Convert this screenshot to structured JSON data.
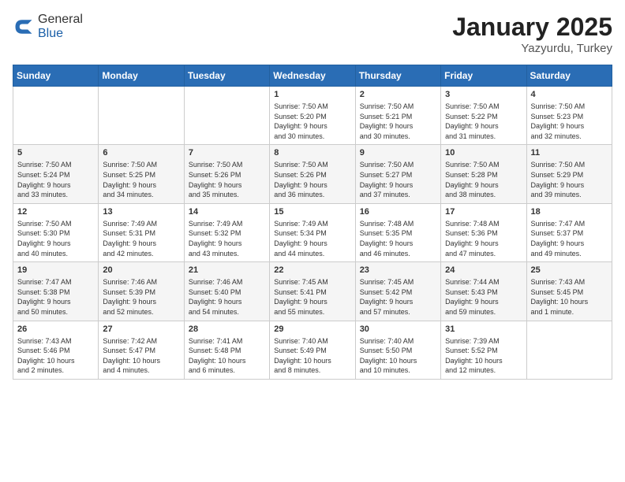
{
  "header": {
    "logo_general": "General",
    "logo_blue": "Blue",
    "title": "January 2025",
    "location": "Yazyurdu, Turkey"
  },
  "weekdays": [
    "Sunday",
    "Monday",
    "Tuesday",
    "Wednesday",
    "Thursday",
    "Friday",
    "Saturday"
  ],
  "weeks": [
    [
      {
        "day": "",
        "info": ""
      },
      {
        "day": "",
        "info": ""
      },
      {
        "day": "",
        "info": ""
      },
      {
        "day": "1",
        "info": "Sunrise: 7:50 AM\nSunset: 5:20 PM\nDaylight: 9 hours\nand 30 minutes."
      },
      {
        "day": "2",
        "info": "Sunrise: 7:50 AM\nSunset: 5:21 PM\nDaylight: 9 hours\nand 30 minutes."
      },
      {
        "day": "3",
        "info": "Sunrise: 7:50 AM\nSunset: 5:22 PM\nDaylight: 9 hours\nand 31 minutes."
      },
      {
        "day": "4",
        "info": "Sunrise: 7:50 AM\nSunset: 5:23 PM\nDaylight: 9 hours\nand 32 minutes."
      }
    ],
    [
      {
        "day": "5",
        "info": "Sunrise: 7:50 AM\nSunset: 5:24 PM\nDaylight: 9 hours\nand 33 minutes."
      },
      {
        "day": "6",
        "info": "Sunrise: 7:50 AM\nSunset: 5:25 PM\nDaylight: 9 hours\nand 34 minutes."
      },
      {
        "day": "7",
        "info": "Sunrise: 7:50 AM\nSunset: 5:26 PM\nDaylight: 9 hours\nand 35 minutes."
      },
      {
        "day": "8",
        "info": "Sunrise: 7:50 AM\nSunset: 5:26 PM\nDaylight: 9 hours\nand 36 minutes."
      },
      {
        "day": "9",
        "info": "Sunrise: 7:50 AM\nSunset: 5:27 PM\nDaylight: 9 hours\nand 37 minutes."
      },
      {
        "day": "10",
        "info": "Sunrise: 7:50 AM\nSunset: 5:28 PM\nDaylight: 9 hours\nand 38 minutes."
      },
      {
        "day": "11",
        "info": "Sunrise: 7:50 AM\nSunset: 5:29 PM\nDaylight: 9 hours\nand 39 minutes."
      }
    ],
    [
      {
        "day": "12",
        "info": "Sunrise: 7:50 AM\nSunset: 5:30 PM\nDaylight: 9 hours\nand 40 minutes."
      },
      {
        "day": "13",
        "info": "Sunrise: 7:49 AM\nSunset: 5:31 PM\nDaylight: 9 hours\nand 42 minutes."
      },
      {
        "day": "14",
        "info": "Sunrise: 7:49 AM\nSunset: 5:32 PM\nDaylight: 9 hours\nand 43 minutes."
      },
      {
        "day": "15",
        "info": "Sunrise: 7:49 AM\nSunset: 5:34 PM\nDaylight: 9 hours\nand 44 minutes."
      },
      {
        "day": "16",
        "info": "Sunrise: 7:48 AM\nSunset: 5:35 PM\nDaylight: 9 hours\nand 46 minutes."
      },
      {
        "day": "17",
        "info": "Sunrise: 7:48 AM\nSunset: 5:36 PM\nDaylight: 9 hours\nand 47 minutes."
      },
      {
        "day": "18",
        "info": "Sunrise: 7:47 AM\nSunset: 5:37 PM\nDaylight: 9 hours\nand 49 minutes."
      }
    ],
    [
      {
        "day": "19",
        "info": "Sunrise: 7:47 AM\nSunset: 5:38 PM\nDaylight: 9 hours\nand 50 minutes."
      },
      {
        "day": "20",
        "info": "Sunrise: 7:46 AM\nSunset: 5:39 PM\nDaylight: 9 hours\nand 52 minutes."
      },
      {
        "day": "21",
        "info": "Sunrise: 7:46 AM\nSunset: 5:40 PM\nDaylight: 9 hours\nand 54 minutes."
      },
      {
        "day": "22",
        "info": "Sunrise: 7:45 AM\nSunset: 5:41 PM\nDaylight: 9 hours\nand 55 minutes."
      },
      {
        "day": "23",
        "info": "Sunrise: 7:45 AM\nSunset: 5:42 PM\nDaylight: 9 hours\nand 57 minutes."
      },
      {
        "day": "24",
        "info": "Sunrise: 7:44 AM\nSunset: 5:43 PM\nDaylight: 9 hours\nand 59 minutes."
      },
      {
        "day": "25",
        "info": "Sunrise: 7:43 AM\nSunset: 5:45 PM\nDaylight: 10 hours\nand 1 minute."
      }
    ],
    [
      {
        "day": "26",
        "info": "Sunrise: 7:43 AM\nSunset: 5:46 PM\nDaylight: 10 hours\nand 2 minutes."
      },
      {
        "day": "27",
        "info": "Sunrise: 7:42 AM\nSunset: 5:47 PM\nDaylight: 10 hours\nand 4 minutes."
      },
      {
        "day": "28",
        "info": "Sunrise: 7:41 AM\nSunset: 5:48 PM\nDaylight: 10 hours\nand 6 minutes."
      },
      {
        "day": "29",
        "info": "Sunrise: 7:40 AM\nSunset: 5:49 PM\nDaylight: 10 hours\nand 8 minutes."
      },
      {
        "day": "30",
        "info": "Sunrise: 7:40 AM\nSunset: 5:50 PM\nDaylight: 10 hours\nand 10 minutes."
      },
      {
        "day": "31",
        "info": "Sunrise: 7:39 AM\nSunset: 5:52 PM\nDaylight: 10 hours\nand 12 minutes."
      },
      {
        "day": "",
        "info": ""
      }
    ]
  ]
}
